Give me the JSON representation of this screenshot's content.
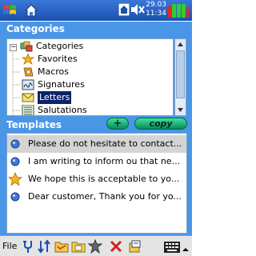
{
  "clock": {
    "date": "29.03",
    "time": "11:34"
  },
  "categories": {
    "header": "Categories",
    "root": "Categories",
    "items": [
      "Favorites",
      "Macros",
      "Signatures",
      "Letters",
      "Salutations"
    ],
    "selected": "Letters"
  },
  "templates": {
    "header": "Templates",
    "add_label": "+",
    "copy_label": "copy",
    "rows": [
      "Please do not hesitate to contact...",
      "I am writing to inform ou that ne...",
      "We hope this is acceptable to yo...",
      "Dear customer, Thank you for yo..."
    ]
  },
  "toolbar": {
    "file_label": "File"
  },
  "icons": {
    "start": "windows-flag-icon",
    "home": "home-icon",
    "volume": "speaker-muted-icon",
    "battery": "battery-signal-icon"
  },
  "colors": {
    "title_bar": "#1a50b0",
    "panel": "#4a96e6",
    "button": "#1fb57a",
    "selection": "#0a246a"
  }
}
